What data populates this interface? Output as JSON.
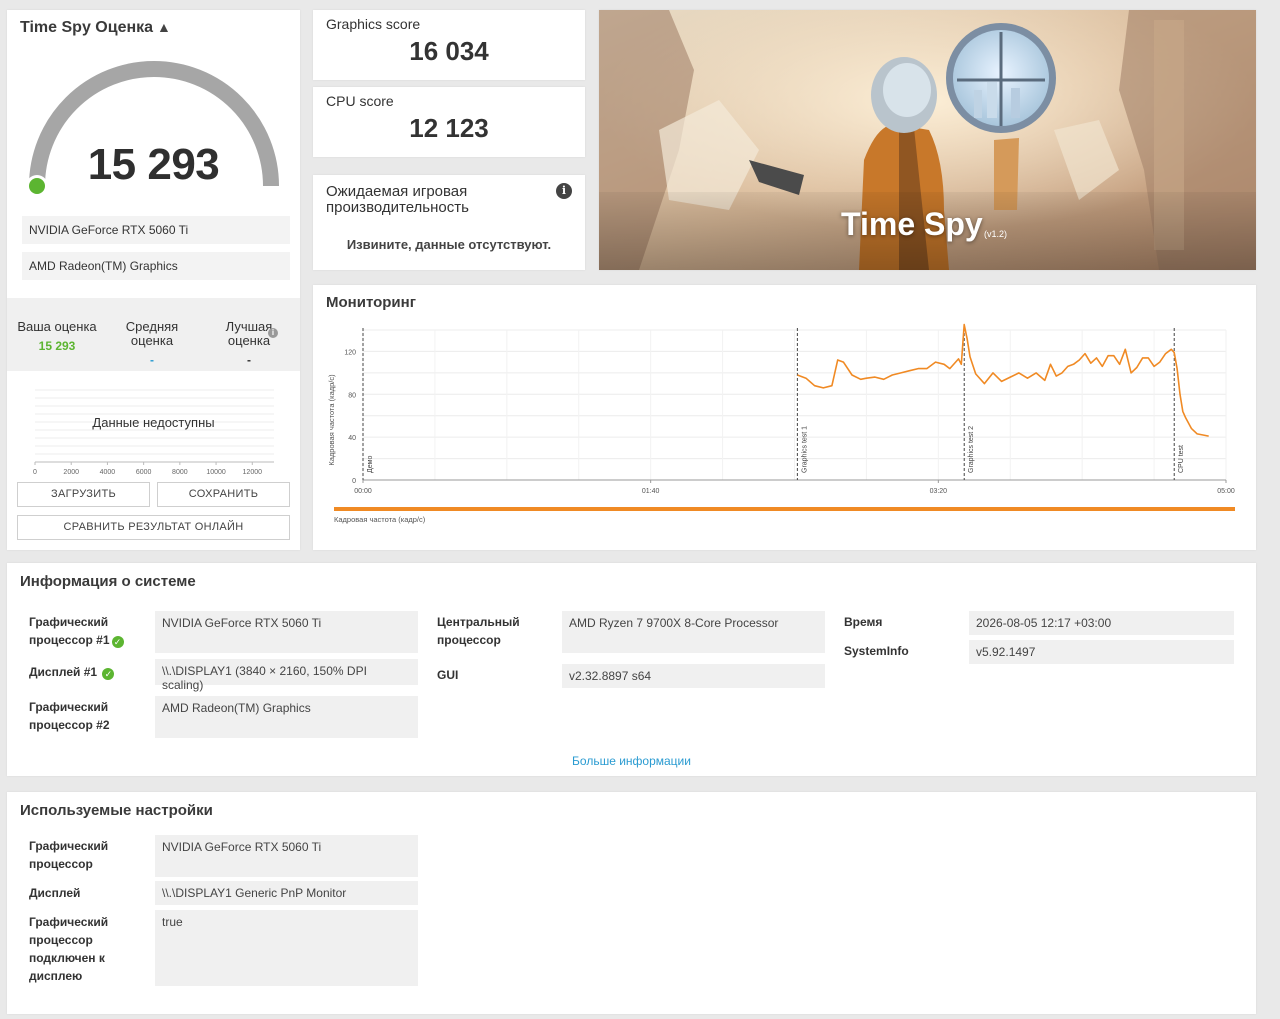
{
  "score_card": {
    "title": "Time Spy Оценка",
    "score": "15 293",
    "devices": [
      "NVIDIA GeForce RTX 5060 Ti",
      "AMD Radeon(TM) Graphics"
    ],
    "compare": {
      "yours_label": "Ваша оценка",
      "yours_value": "15 293",
      "avg_label": "Средняя оценка",
      "avg_value": "-",
      "best_label": "Лучшая оценка",
      "best_value": "-"
    },
    "dist_ticks": [
      "0",
      "2000",
      "4000",
      "6000",
      "8000",
      "10000",
      "12000"
    ],
    "no_data": "Данные недоступны",
    "load_btn": "ЗАГРУЗИТЬ",
    "save_btn": "СОХРАНИТЬ",
    "compare_btn": "СРАВНИТЬ РЕЗУЛЬТАТ ОНЛАЙН",
    "accent": "#5cb531"
  },
  "graphics_score": {
    "label": "Graphics score",
    "value": "16 034"
  },
  "cpu_score": {
    "label": "CPU score",
    "value": "12 123"
  },
  "expected": {
    "title": "Ожидаемая игровая производительность",
    "message": "Извините, данные отсутствуют."
  },
  "hero": {
    "title": "Time Spy",
    "version": "(v1.2)"
  },
  "monitoring": {
    "title": "Мониторинг",
    "legend": "Кадровая частота (кадр/с)",
    "series_color": "#f08a24"
  },
  "chart_data": {
    "type": "line",
    "ylabel": "Кадровая частота (кадр/с)",
    "ylim": [
      0,
      140
    ],
    "yticks": [
      "0",
      "40",
      "80",
      "120"
    ],
    "xlim": [
      0,
      300
    ],
    "xticks": [
      "00:00",
      "01:40",
      "03:20",
      "05:00"
    ],
    "markers": [
      {
        "label": "Демо",
        "x": 0
      },
      {
        "label": "Graphics test 1",
        "x": 151
      },
      {
        "label": "Graphics test 2",
        "x": 209
      },
      {
        "label": "CPU test",
        "x": 282
      }
    ],
    "series": [
      {
        "name": "Кадровая частота (кадр/с)",
        "x": [
          151,
          154,
          157,
          160,
          163,
          165,
          167,
          170,
          173,
          175,
          178,
          181,
          184,
          187,
          190,
          193,
          196,
          199,
          202,
          204,
          206,
          207,
          208,
          209,
          210,
          211,
          213,
          216,
          219,
          222,
          225,
          228,
          231,
          234,
          237,
          239,
          241,
          243,
          245,
          247,
          249,
          251,
          253,
          255,
          257,
          259,
          261,
          263,
          265,
          267,
          269,
          271,
          273,
          275,
          277,
          279,
          281,
          282,
          283,
          284,
          285,
          286,
          288,
          290,
          292,
          294
        ],
        "values": [
          98,
          95,
          88,
          86,
          88,
          112,
          110,
          98,
          94,
          95,
          96,
          94,
          98,
          100,
          102,
          104,
          104,
          110,
          108,
          104,
          110,
          113,
          108,
          145,
          132,
          115,
          99,
          90,
          100,
          92,
          96,
          100,
          95,
          100,
          93,
          108,
          97,
          100,
          106,
          108,
          112,
          118,
          109,
          114,
          106,
          116,
          116,
          108,
          122,
          100,
          105,
          114,
          114,
          106,
          110,
          118,
          122,
          119,
          104,
          80,
          64,
          58,
          48,
          43,
          42,
          41
        ]
      }
    ]
  },
  "sysinfo": {
    "title": "Информация о системе",
    "gpu1_label": "Графический процессор #1",
    "gpu1_value": "NVIDIA GeForce RTX 5060 Ti",
    "display1_label": "Дисплей #1",
    "display1_value": "\\\\.\\DISPLAY1 (3840 × 2160, 150% DPI scaling)",
    "gpu2_label": "Графический процессор #2",
    "gpu2_value": "AMD Radeon(TM) Graphics",
    "cpu_label": "Центральный процессор",
    "cpu_value": "AMD Ryzen 7 9700X 8-Core Processor",
    "gui_label": "GUI",
    "gui_value": "v2.32.8897 s64",
    "time_label": "Время",
    "time_value": "2026-08-05 12:17 +03:00",
    "sysinfo_label": "SystemInfo",
    "sysinfo_value": "v5.92.1497",
    "more": "Больше информации"
  },
  "settings": {
    "title": "Используемые настройки",
    "gpu_label": "Графический процессор",
    "gpu_value": "NVIDIA GeForce RTX 5060 Ti",
    "display_label": "Дисплей",
    "display_value": "\\\\.\\DISPLAY1 Generic PnP Monitor",
    "connected_label": "Графический процессор подключен к дисплею",
    "connected_value": "true"
  }
}
